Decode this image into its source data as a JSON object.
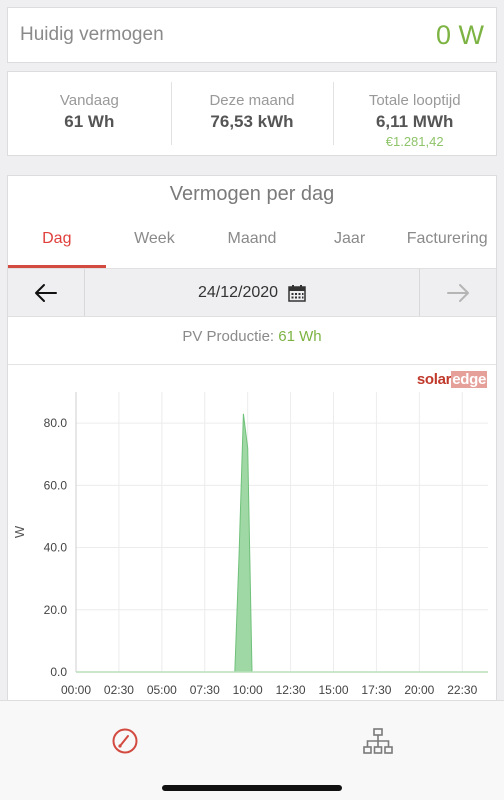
{
  "current_power": {
    "label": "Huidig vermogen",
    "value": "0 W"
  },
  "stats": [
    {
      "title": "Vandaag",
      "value": "61 Wh",
      "money": ""
    },
    {
      "title": "Deze maand",
      "value": "76,53 kWh",
      "money": ""
    },
    {
      "title": "Totale looptijd",
      "value": "6,11 MWh",
      "money": "€1.281,42"
    }
  ],
  "chart_card": {
    "title": "Vermogen per dag",
    "tabs": [
      "Dag",
      "Week",
      "Maand",
      "Jaar",
      "Facturering"
    ],
    "active_tab": "Dag",
    "date": "24/12/2020",
    "production_label": "PV Productie:",
    "production_value": "61 Wh",
    "logo_solar": "solar",
    "logo_edge": "edge"
  },
  "icons": {
    "prev": "arrow-left-icon",
    "next": "arrow-right-icon",
    "calendar": "calendar-icon",
    "dashboard": "gauge-icon",
    "layout": "site-layout-icon"
  },
  "colors": {
    "accent": "#d24a40",
    "power_green": "#7cb342",
    "area_fill": "#9fd8a4",
    "area_stroke": "#6fc17a"
  },
  "chart_data": {
    "type": "area",
    "title": "",
    "xlabel": "",
    "ylabel": "W",
    "x_ticks": [
      "00:00",
      "02:30",
      "05:00",
      "07:30",
      "10:00",
      "12:30",
      "15:00",
      "17:30",
      "20:00",
      "22:30"
    ],
    "y_ticks": [
      "0.0",
      "20.0",
      "40.0",
      "60.0",
      "80.0"
    ],
    "ylim": [
      0,
      90
    ],
    "xlim_hours": [
      0,
      24
    ],
    "grid": true,
    "series": [
      {
        "points": [
          [
            0,
            0
          ],
          [
            9.0,
            0
          ],
          [
            9.25,
            0
          ],
          [
            9.5,
            38
          ],
          [
            9.75,
            83
          ],
          [
            10.0,
            72
          ],
          [
            10.25,
            0
          ],
          [
            10.5,
            0
          ],
          [
            24,
            0
          ]
        ]
      }
    ]
  }
}
